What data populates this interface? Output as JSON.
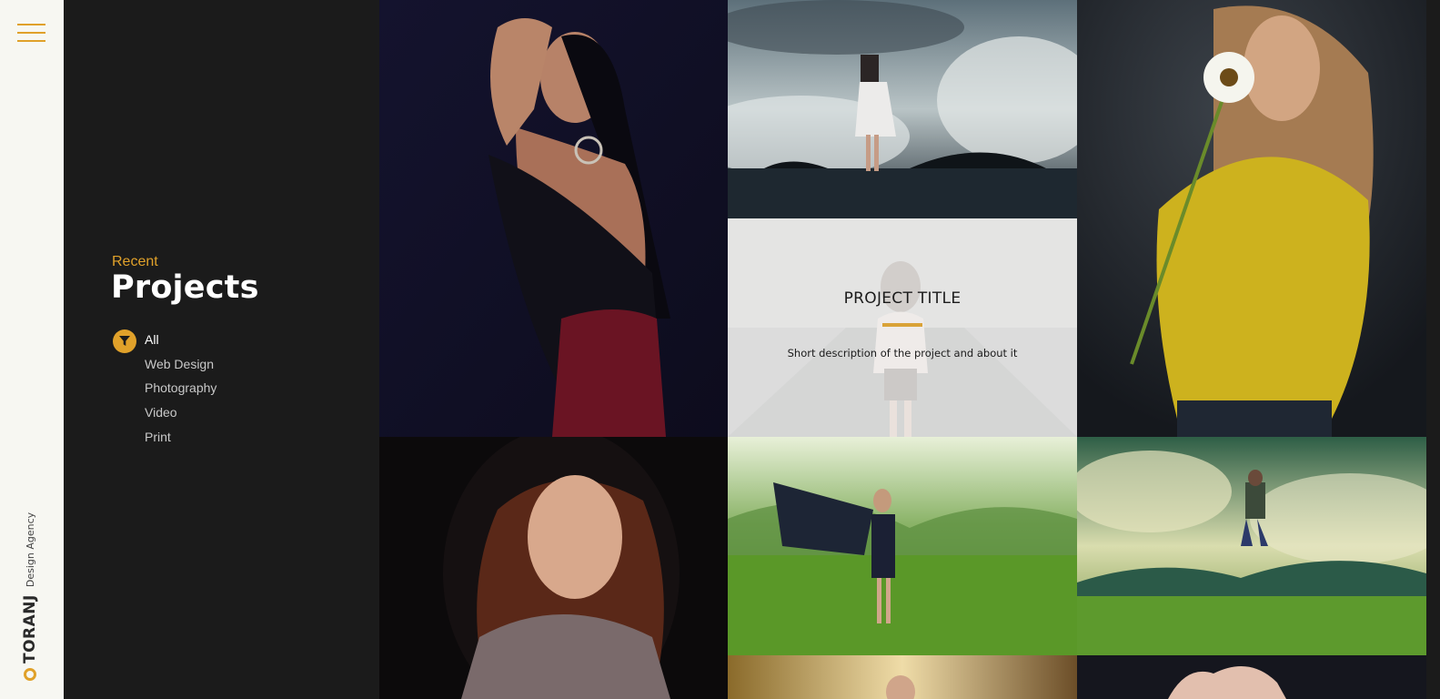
{
  "brand": {
    "name": "TORANJ",
    "tagline": "Design Agency"
  },
  "section": {
    "kicker": "Recent",
    "title": "Projects"
  },
  "filters": [
    {
      "label": "All",
      "active": true
    },
    {
      "label": "Web Design",
      "active": false
    },
    {
      "label": "Photography",
      "active": false
    },
    {
      "label": "Video",
      "active": false
    },
    {
      "label": "Print",
      "active": false
    }
  ],
  "featured_project": {
    "title": "PROJECT TITLE",
    "description": "Short description of the project and about it"
  },
  "colors": {
    "accent": "#e0a12a",
    "sidebar_bg": "#1b1b1b",
    "rail_bg": "#f7f7f2"
  },
  "icons": {
    "menu": "hamburger-icon",
    "filter": "filter-icon",
    "logo": "ring-logo-icon"
  }
}
